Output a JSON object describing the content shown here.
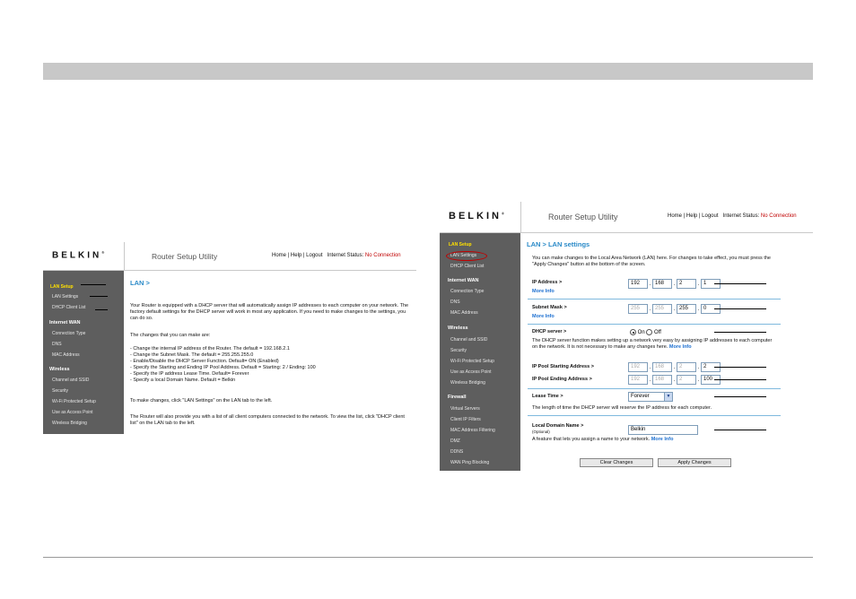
{
  "brand": "BELKIN",
  "app_title": "Router Setup Utility",
  "nav": {
    "home": "Home",
    "help": "Help",
    "logout": "Logout",
    "status_label": "Internet Status:",
    "status_value": "No Connection"
  },
  "sidebar": {
    "lan_setup": "LAN Setup",
    "lan_settings": "LAN Settings",
    "dhcp_client_list": "DHCP Client List",
    "internet_wan": "Internet WAN",
    "connection_type": "Connection Type",
    "dns": "DNS",
    "mac_address": "MAC Address",
    "wireless": "Wireless",
    "channel_ssid": "Channel and SSID",
    "security": "Security",
    "wps": "Wi-Fi Protected Setup",
    "access_point": "Use as Access Point",
    "wireless_bridging": "Wireless Bridging",
    "firewall": "Firewall",
    "virtual_servers": "Virtual Servers",
    "client_ip_filters": "Client IP Filters",
    "mac_filtering": "MAC Address Filtering",
    "dmz": "DMZ",
    "ddns": "DDNS",
    "wan_ping_blocking": "WAN Ping Blocking"
  },
  "lan_page": {
    "heading": "LAN >",
    "intro": "Your Router is equipped with a DHCP server that will automatically assign IP addresses to each computer on your network. The factory default settings for the DHCP server will work in most any application. If you need to make changes to the settings, you can do so.",
    "changes_intro": "The changes that you can make are:",
    "changes": [
      "- Change the internal IP address of the Router. The default = 192.168.2.1",
      "- Change the Subnet Mask. The default = 255.255.255.0",
      "- Enable/Disable the DHCP Server Function. Default= ON (Enabled)",
      "- Specify the Starting and Ending IP Pool Address. Default = Starting: 2 / Ending: 100",
      "- Specify the IP address Lease Time. Default= Forever",
      "- Specify a local Domain Name. Default = Belkin"
    ],
    "to_make_changes": "To make changes, click \"LAN Settings\" on the LAN tab to the left.",
    "client_list_text": "The Router will also provide you with a list of all client computers connected to the network. To view the list, click \"DHCP client list\" on the LAN tab to the left."
  },
  "lan_settings_page": {
    "heading": "LAN > LAN settings",
    "intro": "You can make changes to the Local Area Network (LAN) here. For changes to take effect, you must press the \"Apply Changes\" button at the bottom of the screen.",
    "ip_label": "IP Address >",
    "ip": [
      "192",
      "168",
      "2",
      "1"
    ],
    "more_info": "More Info",
    "subnet_label": "Subnet Mask >",
    "subnet": [
      "255",
      "255",
      "255",
      "0"
    ],
    "dhcp_label": "DHCP server >",
    "dhcp_on": "On",
    "dhcp_off": "Off",
    "dhcp_desc": "The DHCP server function makes setting up a network very easy by assigning IP addresses to each computer on the network. It is not necessary to make any changes here.",
    "pool_start_label": "IP Pool Starting Address >",
    "pool_start": [
      "192",
      "168",
      "2",
      "2"
    ],
    "pool_end_label": "IP Pool Ending Address >",
    "pool_end": [
      "192",
      "168",
      "2",
      "100"
    ],
    "lease_label": "Lease Time >",
    "lease_value": "Forever",
    "lease_desc": "The length of time the DHCP server will reserve the IP address for each computer.",
    "domain_label": "Local Domain Name >",
    "domain_optional": "(Optional)",
    "domain_value": "Belkin",
    "domain_desc": "A feature that lets you assign a name to your network.",
    "clear_button": "Clear Changes",
    "apply_button": "Apply Changes"
  }
}
